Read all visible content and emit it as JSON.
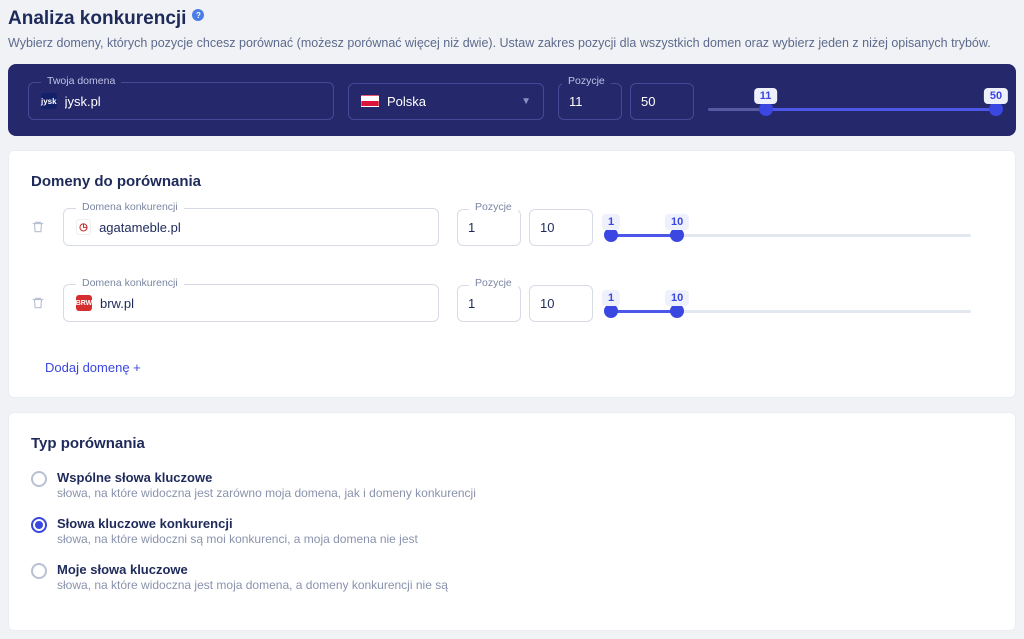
{
  "header": {
    "title": "Analiza konkurencji",
    "subtitle": "Wybierz domeny, których pozycje chcesz porównać (możesz porównać więcej niż dwie). Ustaw zakres pozycji dla wszystkich domen oraz wybierz jeden z niżej opisanych trybów."
  },
  "hero": {
    "domain_label": "Twoja domena",
    "domain_value": "jysk.pl",
    "country": "Polska",
    "positions_label": "Pozycje",
    "pos_min": "11",
    "pos_max": "50",
    "slider": {
      "min": 11,
      "max": 50,
      "track_min": 1,
      "track_max": 50
    }
  },
  "competitors": {
    "section_title": "Domeny do porównania",
    "domain_label": "Domena konkurencji",
    "positions_label": "Pozycje",
    "rows": [
      {
        "domain": "agatameble.pl",
        "favicon": "agata",
        "pos_min": "1",
        "pos_max": "10",
        "slider": {
          "min": 1,
          "max": 10,
          "track_min": 1,
          "track_max": 50
        }
      },
      {
        "domain": "brw.pl",
        "favicon": "brw",
        "pos_min": "1",
        "pos_max": "10",
        "slider": {
          "min": 1,
          "max": 10,
          "track_min": 1,
          "track_max": 50
        }
      }
    ],
    "add_label": "Dodaj domenę +"
  },
  "comparison": {
    "section_title": "Typ porównania",
    "options": [
      {
        "title": "Wspólne słowa kluczowe",
        "desc": "słowa, na które widoczna jest zarówno moja domena, jak i domeny konkurencji",
        "checked": false
      },
      {
        "title": "Słowa kluczowe konkurencji",
        "desc": "słowa, na które widoczni są moi konkurenci, a moja domena nie jest",
        "checked": true
      },
      {
        "title": "Moje słowa kluczowe",
        "desc": "słowa, na które widoczna jest moja domena, a domeny konkurencji nie są",
        "checked": false
      }
    ]
  }
}
